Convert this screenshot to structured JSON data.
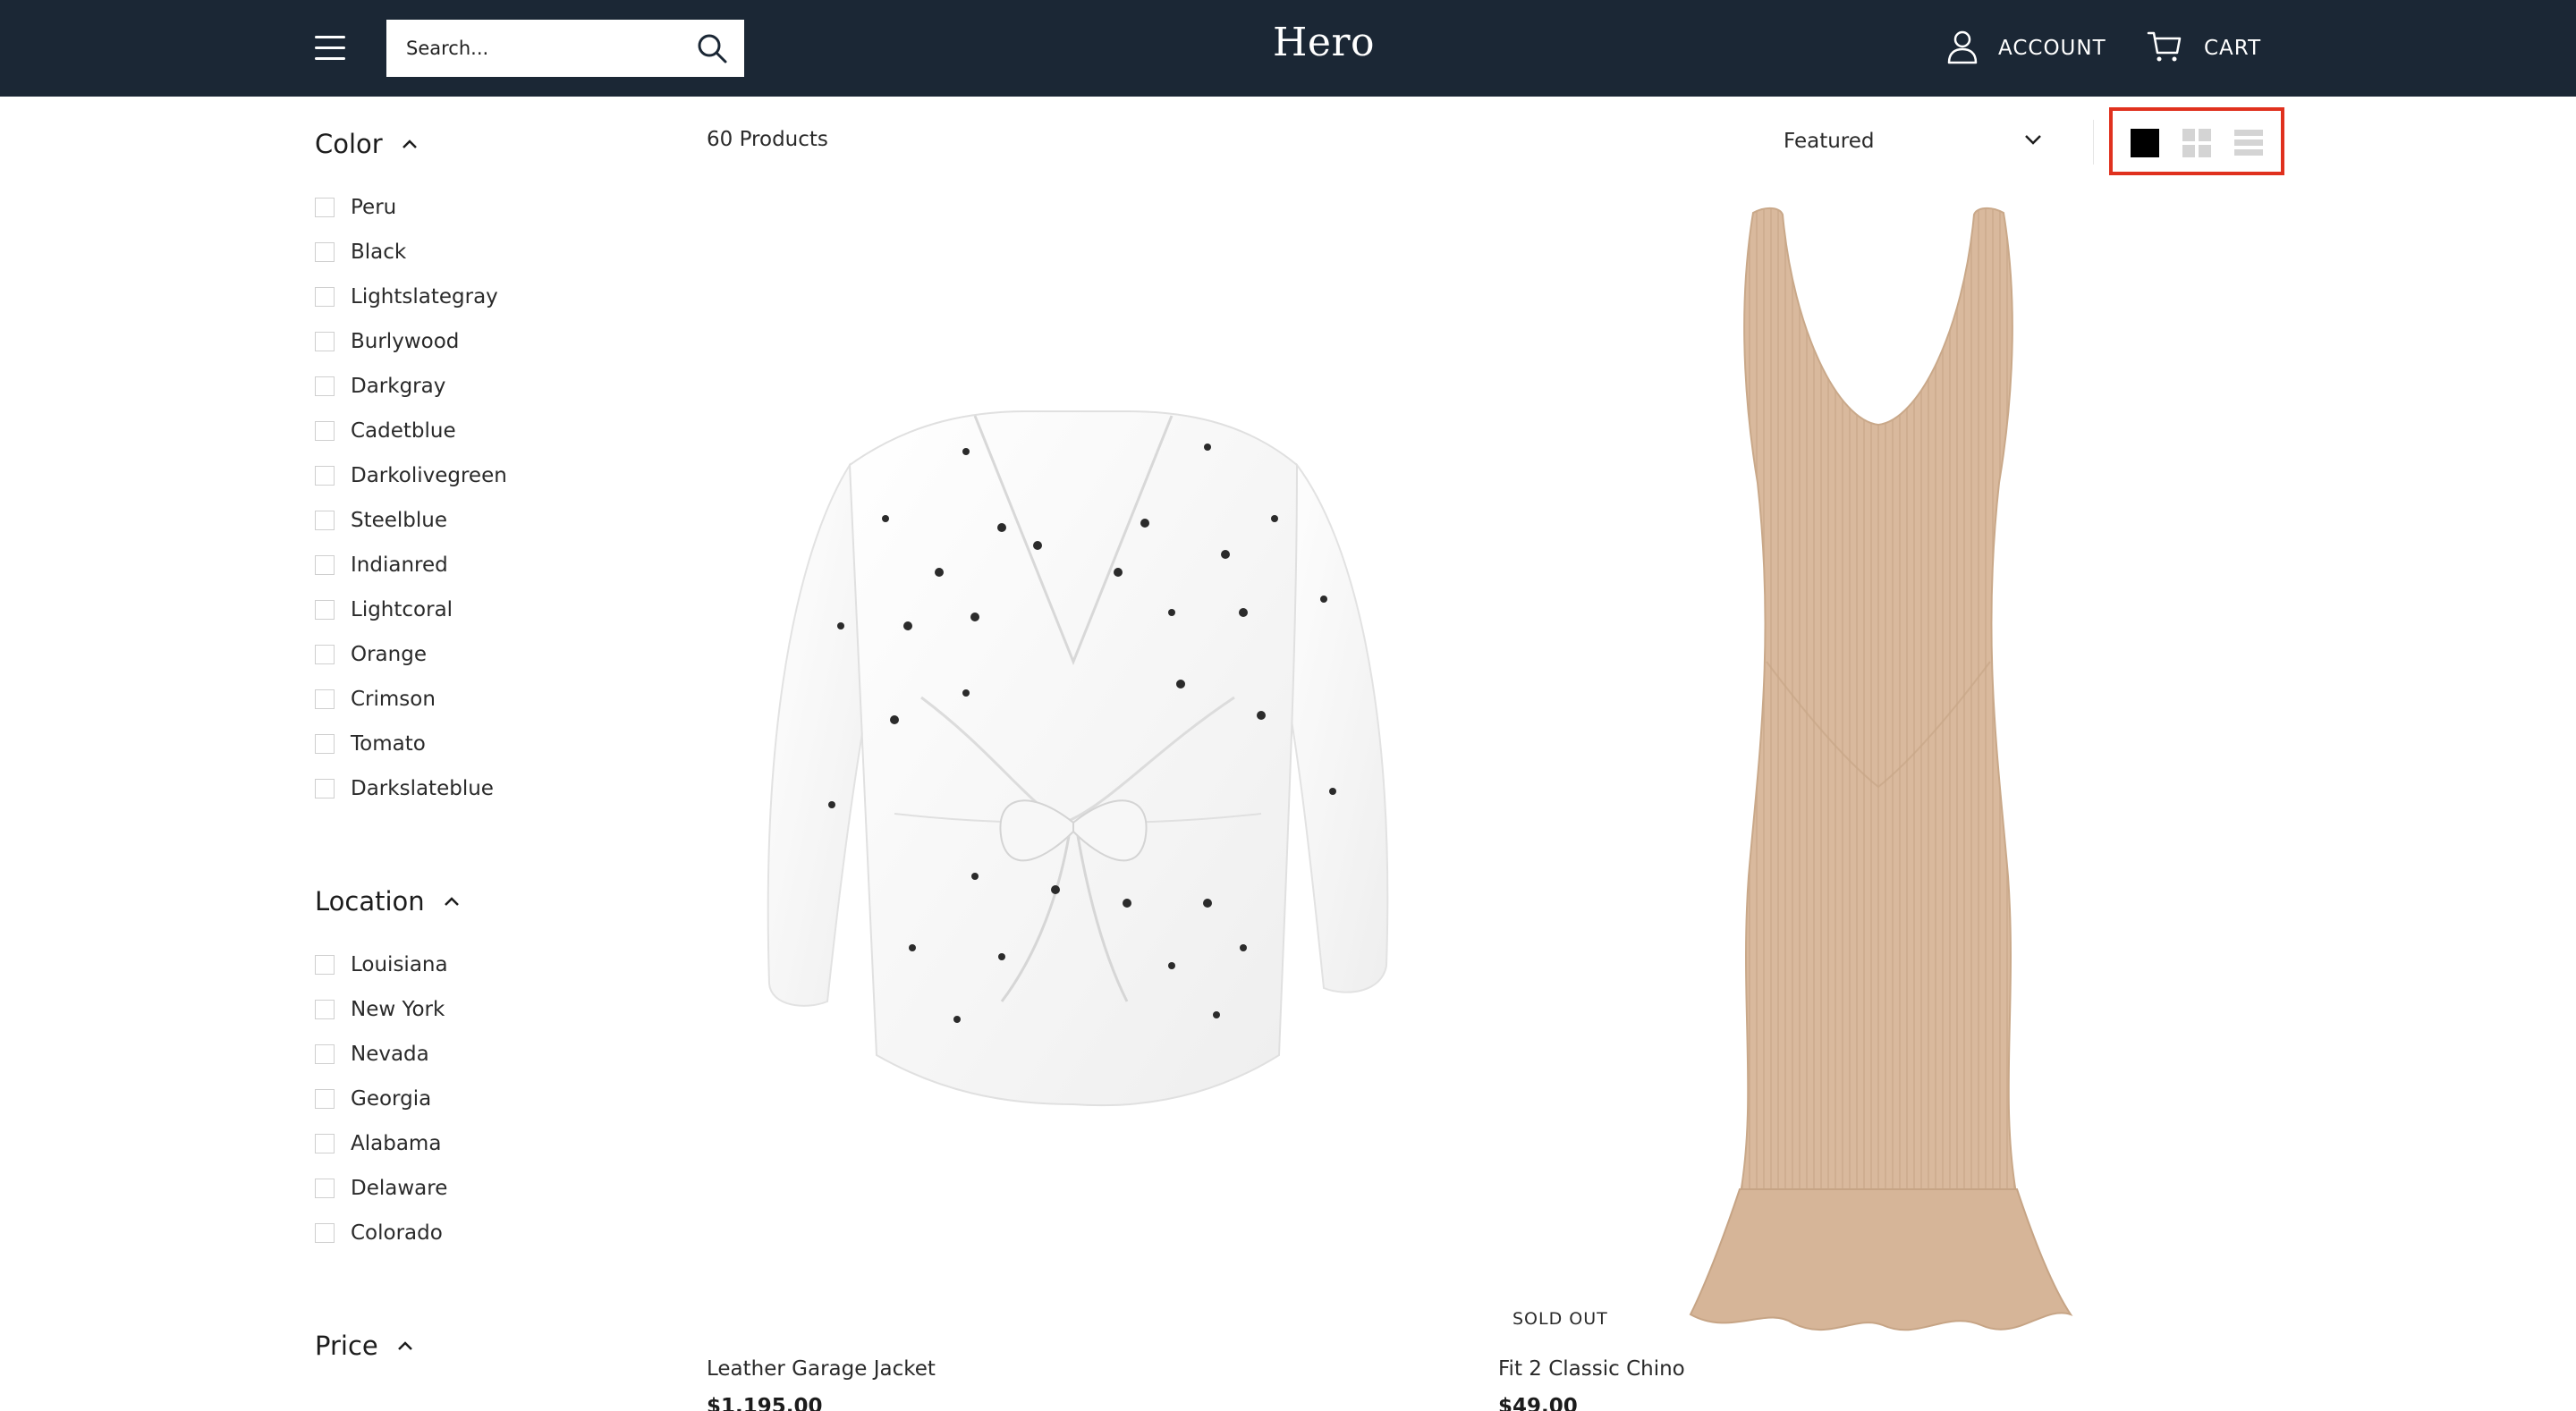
{
  "header": {
    "search_placeholder": "Search...",
    "logo": "Hero",
    "account_label": "ACCOUNT",
    "cart_label": "CART",
    "background_color": "#1b2735",
    "icons": {
      "menu": "hamburger-menu-icon",
      "search": "search-icon",
      "account": "user-icon",
      "cart": "cart-icon"
    }
  },
  "filters": {
    "color": {
      "heading": "Color",
      "options": [
        "Peru",
        "Black",
        "Lightslategray",
        "Burlywood",
        "Darkgray",
        "Cadetblue",
        "Darkolivegreen",
        "Steelblue",
        "Indianred",
        "Lightcoral",
        "Orange",
        "Crimson",
        "Tomato",
        "Darkslateblue"
      ]
    },
    "location": {
      "heading": "Location",
      "options": [
        "Louisiana",
        "New York",
        "Nevada",
        "Georgia",
        "Alabama",
        "Delaware",
        "Colorado"
      ]
    },
    "price": {
      "heading": "Price"
    }
  },
  "toolbar": {
    "product_count": "60 Products",
    "sort_selected": "Featured",
    "view_modes": [
      "large-grid",
      "small-grid",
      "list"
    ],
    "active_view": "large-grid",
    "highlight_color": "#e0311e"
  },
  "products": [
    {
      "title": "Leather Garage Jacket",
      "price": "$1,195.00",
      "sold_out": false
    },
    {
      "title": "Fit 2 Classic Chino",
      "price": "$49.00",
      "sold_out": true,
      "badge": "SOLD OUT"
    }
  ]
}
